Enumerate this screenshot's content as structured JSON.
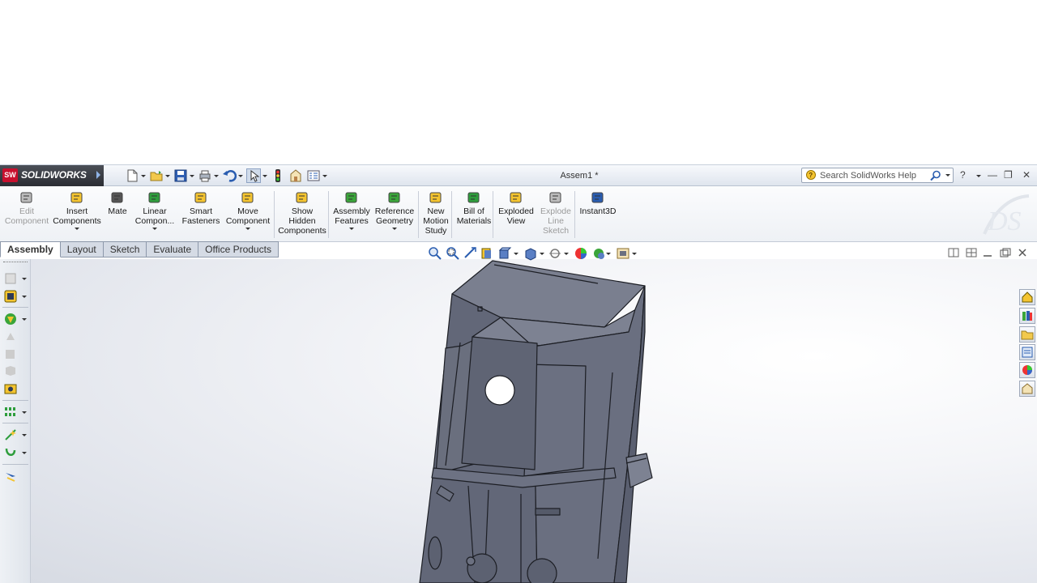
{
  "app": {
    "name": "SOLIDWORKS",
    "logo_text": "SW",
    "document_title": "Assem1 *"
  },
  "search": {
    "placeholder": "Search SolidWorks Help"
  },
  "window_controls": {
    "help": "?",
    "minimize": "—",
    "restore": "❐",
    "close": "✕"
  },
  "command_manager": {
    "items": [
      {
        "label1": "Edit",
        "label2": "Component",
        "label3": "",
        "icon": "edit-component-icon",
        "enabled": false,
        "dropdown": false
      },
      {
        "label1": "Insert",
        "label2": "Components",
        "label3": "",
        "icon": "insert-components-icon",
        "enabled": true,
        "dropdown": true
      },
      {
        "label1": "Mate",
        "label2": "",
        "label3": "",
        "icon": "mate-icon",
        "enabled": true,
        "dropdown": false
      },
      {
        "label1": "Linear",
        "label2": "Compon...",
        "label3": "",
        "icon": "linear-pattern-icon",
        "enabled": true,
        "dropdown": true
      },
      {
        "label1": "Smart",
        "label2": "Fasteners",
        "label3": "",
        "icon": "smart-fasteners-icon",
        "enabled": true,
        "dropdown": false
      },
      {
        "label1": "Move",
        "label2": "Component",
        "label3": "",
        "icon": "move-component-icon",
        "enabled": true,
        "dropdown": true
      },
      {
        "label1": "Show",
        "label2": "Hidden",
        "label3": "Components",
        "icon": "show-hidden-icon",
        "enabled": true,
        "dropdown": false
      },
      {
        "label1": "Assembly",
        "label2": "Features",
        "label3": "",
        "icon": "assembly-features-icon",
        "enabled": true,
        "dropdown": true
      },
      {
        "label1": "Reference",
        "label2": "Geometry",
        "label3": "",
        "icon": "reference-geometry-icon",
        "enabled": true,
        "dropdown": true
      },
      {
        "label1": "New",
        "label2": "Motion",
        "label3": "Study",
        "icon": "motion-study-icon",
        "enabled": true,
        "dropdown": false
      },
      {
        "label1": "Bill of",
        "label2": "Materials",
        "label3": "",
        "icon": "bill-of-materials-icon",
        "enabled": true,
        "dropdown": false
      },
      {
        "label1": "Exploded",
        "label2": "View",
        "label3": "",
        "icon": "exploded-view-icon",
        "enabled": true,
        "dropdown": false
      },
      {
        "label1": "Explode",
        "label2": "Line",
        "label3": "Sketch",
        "icon": "explode-line-sketch-icon",
        "enabled": false,
        "dropdown": false
      },
      {
        "label1": "Instant3D",
        "label2": "",
        "label3": "",
        "icon": "instant3d-icon",
        "enabled": true,
        "dropdown": false
      }
    ]
  },
  "tabs": [
    "Assembly",
    "Layout",
    "Sketch",
    "Evaluate",
    "Office Products"
  ],
  "active_tab": "Assembly",
  "colors": {
    "accent": "#c8102e",
    "model": "#6b7080",
    "model_edge": "#1c1e24"
  }
}
